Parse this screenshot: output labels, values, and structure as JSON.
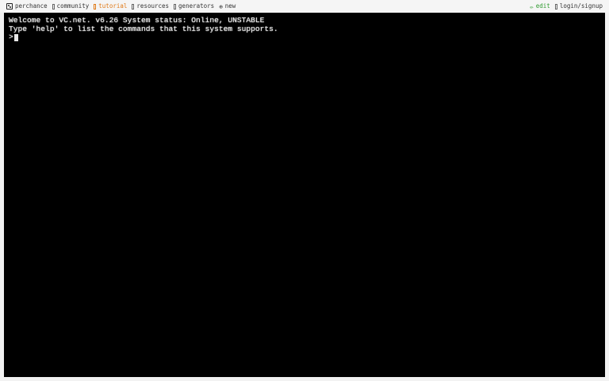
{
  "nav": {
    "left": [
      {
        "label": "perchance",
        "icon": "dice-icon",
        "color": "#333333"
      },
      {
        "label": "community",
        "icon": "box-icon",
        "color": "#333333"
      },
      {
        "label": "tutorial",
        "icon": "box-icon",
        "color": "#e07a18"
      },
      {
        "label": "resources",
        "icon": "box-icon",
        "color": "#333333"
      },
      {
        "label": "generators",
        "icon": "box-icon",
        "color": "#333333"
      },
      {
        "label": "new",
        "icon": "plus-circle-icon",
        "color": "#333333"
      }
    ],
    "right": [
      {
        "label": "edit",
        "icon": "pencil-icon",
        "color": "#2f9a2f"
      },
      {
        "label": "login/signup",
        "icon": "box-icon",
        "color": "#333333"
      }
    ]
  },
  "terminal": {
    "lines": [
      "Welcome to VC.net. v6.26 System status: Online, UNSTABLE",
      "Type 'help' to list the commands that this system supports."
    ],
    "prompt": ">",
    "background": "#000000",
    "text_color": "#e8e8e8"
  }
}
